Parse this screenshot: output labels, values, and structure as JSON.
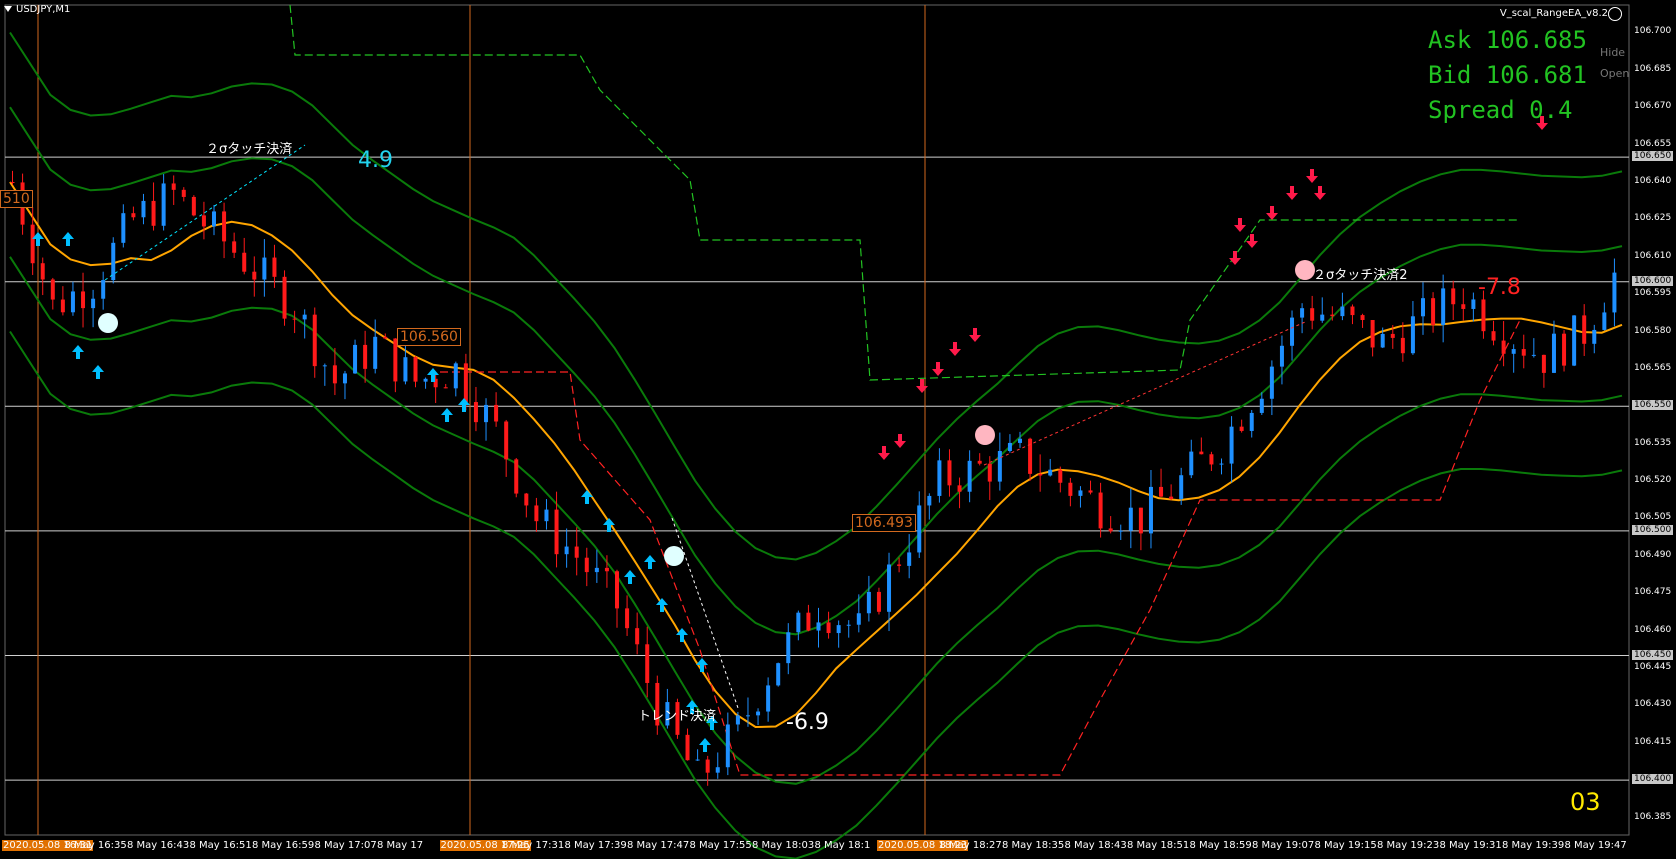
{
  "window": {
    "symbol": "USDJPY,M1",
    "ea_name": "V_scal_RangeEA_v8.2"
  },
  "quotes": {
    "ask": "Ask 106.685",
    "bid": "Bid 106.681",
    "spread": "Spread 0.4"
  },
  "buttons": {
    "hide": "Hide",
    "open": "Open"
  },
  "annotations": {
    "touch_close_1": "２σタッチ決済",
    "touch_close_2": "２σタッチ決済2",
    "trend_close": "トレンド決済",
    "pl_1": "4.9",
    "pl_2": "-6.9",
    "pl_3": "-7.8",
    "marker_510": "510",
    "box_1": "106.560",
    "box_2": "106.493",
    "counter": "03"
  },
  "price_axis": [
    "106.700",
    "106.685",
    "106.670",
    "106.655",
    "106.650",
    "106.640",
    "106.625",
    "106.610",
    "106.600",
    "106.595",
    "106.580",
    "106.565",
    "106.550",
    "106.535",
    "106.520",
    "106.505",
    "106.500",
    "106.490",
    "106.475",
    "106.460",
    "106.450",
    "106.445",
    "106.430",
    "106.415",
    "106.400",
    "106.385"
  ],
  "price_axis_highlight": [
    "106.650",
    "106.600",
    "106.550",
    "106.500",
    "106.450",
    "106.400"
  ],
  "time_axis": [
    "2020.05.08 16:31",
    "8 May 16:35",
    "8 May 16:43",
    "8 May 16:51",
    "8 May 16:59",
    "8 May 17:07",
    "8 May 17",
    "2020.05.08 17:25",
    "8 May 17:31",
    "8 May 17:39",
    "8 May 17:47",
    "8 May 17:55",
    "8 May 18:03",
    "8 May 18:1",
    "2020.05.08 18:23",
    "8 May 18:27",
    "8 May 18:35",
    "8 May 18:43",
    "8 May 18:51",
    "8 May 18:59",
    "8 May 19:07",
    "8 May 19:15",
    "8 May 19:23",
    "8 May 19:31",
    "8 May 19:39",
    "8 May 19:47"
  ],
  "colors": {
    "bull": "#1e90ff",
    "bear": "#ff1a1a",
    "bands": "#0a7a0a",
    "ma": "#ffa500",
    "grid": "#ffffff",
    "buy_arrow": "#00bfff",
    "sell_arrow": "#ff1a4a"
  },
  "chart_data": {
    "type": "candlestick",
    "symbol": "USDJPY",
    "timeframe": "M1",
    "ylim": [
      106.38,
      106.705
    ],
    "close_path": [
      [
        0,
        106.64
      ],
      [
        4,
        106.59
      ],
      [
        8,
        106.6
      ],
      [
        12,
        106.625
      ],
      [
        16,
        106.635
      ],
      [
        20,
        106.62
      ],
      [
        24,
        106.605
      ],
      [
        28,
        106.59
      ],
      [
        32,
        106.56
      ],
      [
        36,
        106.575
      ],
      [
        40,
        106.56
      ],
      [
        44,
        106.565
      ],
      [
        48,
        106.54
      ],
      [
        52,
        106.505
      ],
      [
        56,
        106.49
      ],
      [
        60,
        106.47
      ],
      [
        64,
        106.43
      ],
      [
        68,
        106.4
      ],
      [
        72,
        106.42
      ],
      [
        76,
        106.45
      ],
      [
        80,
        106.47
      ],
      [
        84,
        106.46
      ],
      [
        88,
        106.49
      ],
      [
        92,
        106.52
      ],
      [
        96,
        106.525
      ],
      [
        100,
        106.53
      ],
      [
        104,
        106.52
      ],
      [
        108,
        106.51
      ],
      [
        112,
        106.505
      ],
      [
        116,
        106.52
      ],
      [
        120,
        106.535
      ],
      [
        124,
        106.56
      ],
      [
        128,
        106.59
      ],
      [
        132,
        106.585
      ],
      [
        136,
        106.575
      ],
      [
        140,
        106.585
      ],
      [
        144,
        106.595
      ],
      [
        148,
        106.58
      ],
      [
        152,
        106.57
      ],
      [
        156,
        106.58
      ],
      [
        160,
        106.61
      ]
    ]
  }
}
